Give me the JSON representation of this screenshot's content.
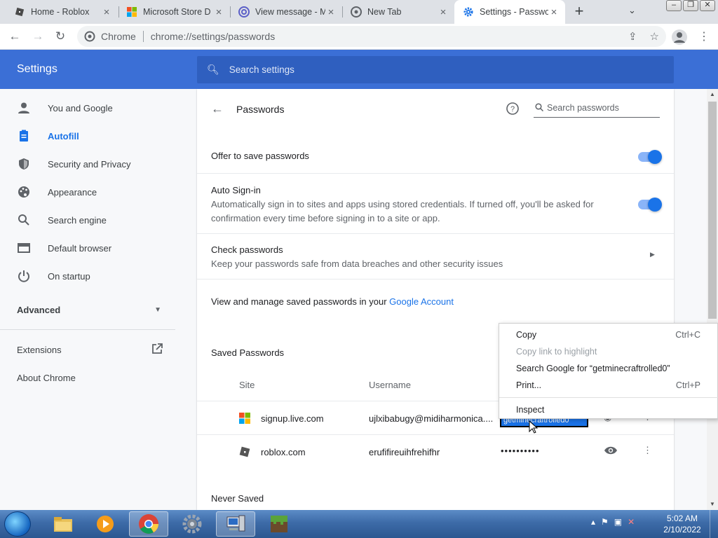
{
  "tabs": [
    {
      "title": "Home - Roblox",
      "icon": "roblox-icon"
    },
    {
      "title": "Microsoft Store D",
      "icon": "microsoft-icon"
    },
    {
      "title": "View message - M",
      "icon": "mail-icon"
    },
    {
      "title": "New Tab",
      "icon": "chrome-icon"
    },
    {
      "title": "Settings - Passwo",
      "icon": "gear-icon"
    }
  ],
  "omnibox": {
    "site_label": "Chrome",
    "url": "chrome://settings/passwords"
  },
  "header": {
    "title": "Settings",
    "search_placeholder": "Search settings"
  },
  "sidebar": {
    "items": [
      {
        "label": "You and Google",
        "icon": "person-icon"
      },
      {
        "label": "Autofill",
        "icon": "clipboard-icon"
      },
      {
        "label": "Security and Privacy",
        "icon": "shield-icon"
      },
      {
        "label": "Appearance",
        "icon": "palette-icon"
      },
      {
        "label": "Search engine",
        "icon": "search-icon"
      },
      {
        "label": "Default browser",
        "icon": "browser-icon"
      },
      {
        "label": "On startup",
        "icon": "power-icon"
      }
    ],
    "advanced": "Advanced",
    "extensions": "Extensions",
    "about": "About Chrome"
  },
  "passwords": {
    "title": "Passwords",
    "search_placeholder": "Search passwords",
    "offer_label": "Offer to save passwords",
    "offer_enabled": true,
    "autosignin_title": "Auto Sign-in",
    "autosignin_desc1": "Automatically sign in to sites and apps using stored credentials. If turned off, you'll be asked for",
    "autosignin_desc2": "confirmation every time before signing in to a site or app.",
    "autosignin_enabled": true,
    "check_title": "Check passwords",
    "check_desc": "Keep your passwords safe from data breaches and other security issues",
    "manage_text": "View and manage saved passwords in your",
    "manage_link": "Google Account",
    "saved_title": "Saved Passwords",
    "col_site": "Site",
    "col_username": "Username",
    "entries": [
      {
        "site": "signup.live.com",
        "username": "ujlxibabugy@midiharmonica....",
        "password": "getminecraftrolled0"
      },
      {
        "site": "roblox.com",
        "username": "erufifireuihfrehifhr",
        "password": "••••••••••"
      }
    ],
    "never_saved_title": "Never Saved"
  },
  "context_menu": {
    "items": [
      {
        "label": "Copy",
        "shortcut": "Ctrl+C",
        "enabled": true
      },
      {
        "label": "Copy link to highlight",
        "shortcut": "",
        "enabled": false
      },
      {
        "label": "Search Google for “getminecraftrolled0”",
        "shortcut": "",
        "enabled": true
      },
      {
        "label": "Print...",
        "shortcut": "Ctrl+P",
        "enabled": true
      },
      {
        "label": "Inspect",
        "shortcut": "",
        "enabled": true
      }
    ]
  },
  "taskbar": {
    "time": "5:02 AM",
    "date": "2/10/2022"
  }
}
